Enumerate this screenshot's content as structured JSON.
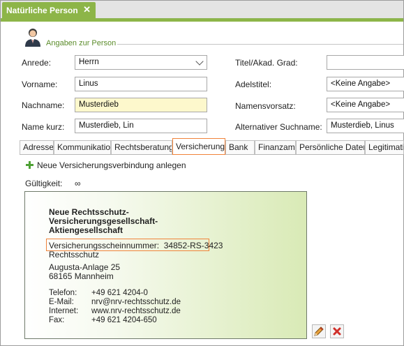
{
  "document_tab": {
    "title": "Natürliche Person",
    "close": "✕"
  },
  "section": {
    "title": "Angaben zur Person",
    "icon": "person-icon"
  },
  "form": {
    "anrede": {
      "label": "Anrede:",
      "value": "Herrn"
    },
    "vorname": {
      "label": "Vorname:",
      "value": "Linus"
    },
    "nachname": {
      "label": "Nachname:",
      "value": "Musterdieb"
    },
    "name_kurz": {
      "label": "Name kurz:",
      "value": "Musterdieb, Lin"
    },
    "titel": {
      "label": "Titel/Akad. Grad:",
      "value": ""
    },
    "adelstitel": {
      "label": "Adelstitel:",
      "value": "<Keine Angabe>"
    },
    "namensvorsatz": {
      "label": "Namensvorsatz:",
      "value": "<Keine Angabe>"
    },
    "alt_suchname": {
      "label": "Alternativer Suchname:",
      "value": "Musterdieb, Linus"
    }
  },
  "tabs": [
    "Adresse",
    "Kommunikation",
    "Rechtsberatung",
    "Versicherung",
    "Bank",
    "Finanzamt",
    "Persönliche Daten",
    "Legitimation"
  ],
  "active_tab": "Versicherung",
  "insurance": {
    "add_label": "Neue Versicherungsverbindung anlegen",
    "validity_label": "Gültigkeit:",
    "validity_value": "∞",
    "card": {
      "company_line1": "Neue Rechtsschutz-",
      "company_line2": "Versicherungsgesellschaft-",
      "company_line3": "Aktiengesellschaft",
      "policy_label": "Versicherungsscheinnummer:",
      "policy_number": "34852-RS-3423",
      "type": "Rechtsschutz",
      "street": "Augusta-Anlage 25",
      "city": "68165 Mannheim",
      "telefon_label": "Telefon:",
      "telefon": "+49 621 4204-0",
      "email_label": "E-Mail:",
      "email": "nrv@nrv-rechtsschutz.de",
      "internet_label": "Internet:",
      "internet": "www.nrv-rechtsschutz.de",
      "fax_label": "Fax:",
      "fax": "+49 621 4204-650"
    }
  },
  "colors": {
    "accent_green": "#8db548",
    "active_tab_border": "#f0833a",
    "required_field": "#fdf8cc",
    "delete_red": "#d0302a"
  }
}
